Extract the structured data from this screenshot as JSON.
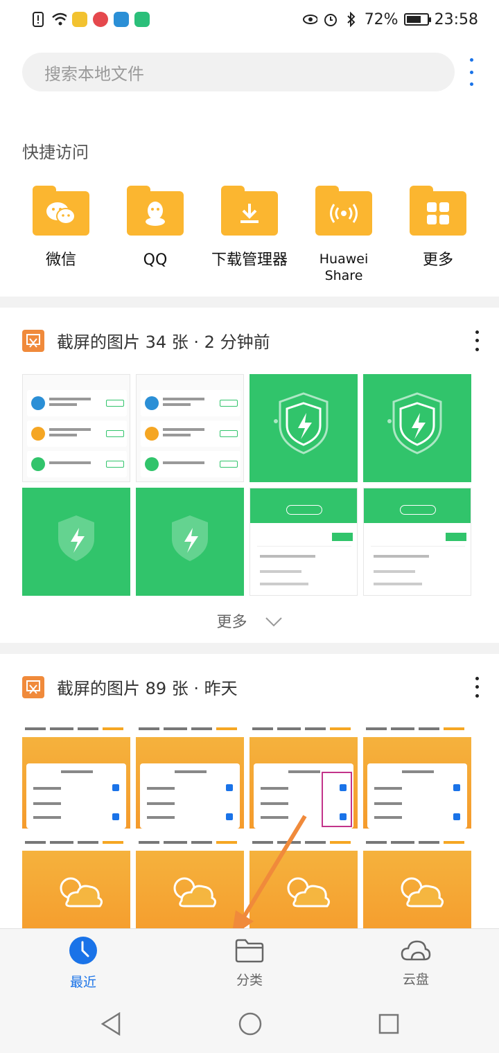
{
  "status_bar": {
    "battery": "72%",
    "time": "23:58"
  },
  "search": {
    "placeholder": "搜索本地文件"
  },
  "quick_access": {
    "title": "快捷访问",
    "items": [
      {
        "label": "微信",
        "icon": "wechat-icon"
      },
      {
        "label": "QQ",
        "icon": "qq-icon"
      },
      {
        "label": "下载管理器",
        "icon": "download-icon"
      },
      {
        "label_line1": "Huawei",
        "label_line2": "Share",
        "icon": "share-wave-icon"
      },
      {
        "label": "更多",
        "icon": "grid-icon"
      }
    ]
  },
  "sections": [
    {
      "title": "截屏的图片 34 张 · 2 分钟前",
      "more_label": "更多"
    },
    {
      "title": "截屏的图片 89 张 · 昨天"
    }
  ],
  "bottom_nav": {
    "items": [
      {
        "label": "最近",
        "icon": "clock-icon",
        "active": true
      },
      {
        "label": "分类",
        "icon": "folder-icon",
        "active": false
      },
      {
        "label": "云盘",
        "icon": "cloud-icon",
        "active": false
      }
    ]
  },
  "colors": {
    "accent": "#1a73e8",
    "folder": "#fbb630",
    "green_thumb": "#31c46b",
    "arrow": "#f08a3b"
  }
}
